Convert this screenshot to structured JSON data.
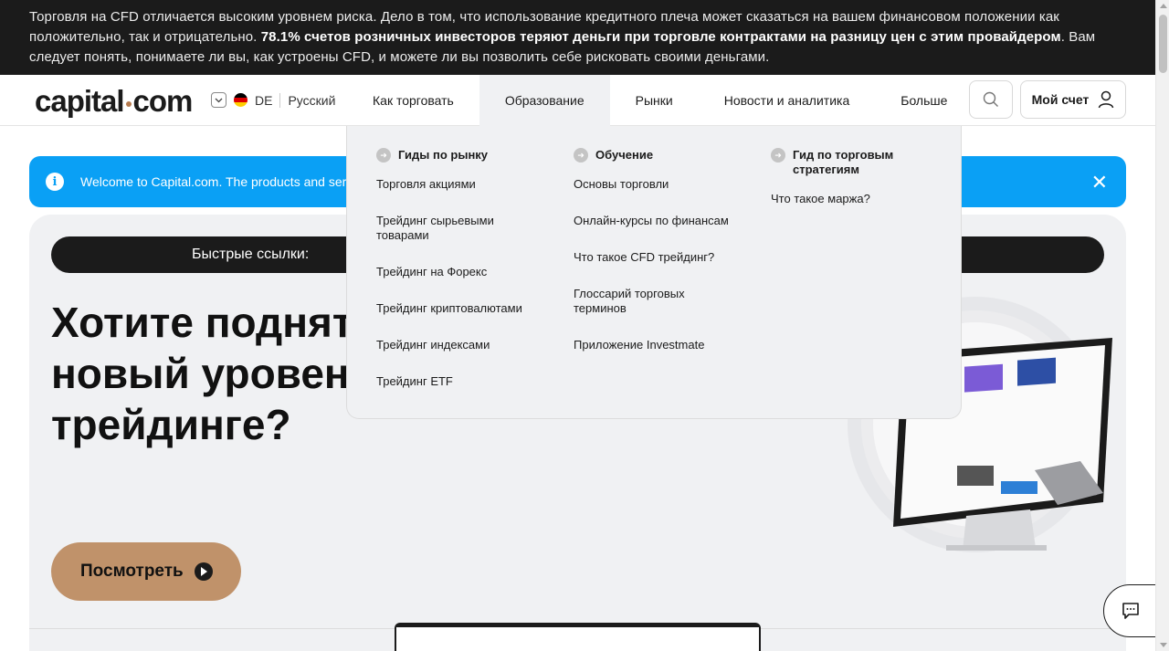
{
  "risk_banner": {
    "text_before": "Торговля на CFD отличается высоким уровнем риска. Дело в том, что использование кредитного плеча может сказаться на вашем финансовом положении как положительно, так и отрицательно. ",
    "text_bold": "78.1% счетов розничных инвесторов теряют деньги при торговле контрактами на разницу цен с этим провайдером",
    "text_after": ". Вам следует понять, понимаете ли вы, как устроены CFD, и можете ли вы позволить себе рисковать своими деньгами."
  },
  "header": {
    "logo_left": "capital",
    "logo_right": "com",
    "country_code": "DE",
    "language": "Русский",
    "nav": [
      {
        "label": "Как торговать"
      },
      {
        "label": "Образование"
      },
      {
        "label": "Рынки"
      },
      {
        "label": "Новости и аналитика"
      },
      {
        "label": "Больше"
      }
    ],
    "account_label": "Мой счет"
  },
  "notice": {
    "text": "Welcome to Capital.com. The products and servic"
  },
  "hero": {
    "quick_links_label": "Быстрые ссылки:",
    "title_line1": "Хотите поднят",
    "title_line2": "новый уровен",
    "title_line3": "трейдинге?",
    "cta_label": "Посмотреть"
  },
  "dropdown": {
    "columns": [
      {
        "heading": "Гиды по рынку",
        "links": [
          "Торговля акциями",
          "Трейдинг сырьевыми товарами",
          "Трейдинг на Форекс",
          "Трейдинг криптовалютами",
          "Трейдинг индексами",
          "Трейдинг ETF"
        ]
      },
      {
        "heading": "Обучение",
        "links": [
          "Основы торговли",
          "Онлайн-курсы по финансам",
          "Что такое CFD трейдинг?",
          "Глоссарий торговых терминов",
          "Приложение Investmate"
        ]
      },
      {
        "heading": "Гид по торговым стратегиям",
        "links": [
          "Что такое маржа?"
        ]
      }
    ]
  },
  "colors": {
    "dark": "#1b1b1b",
    "accent": "#c0926a",
    "notice_blue": "#0aa0f5",
    "panel": "#f0f1f3"
  },
  "icons": [
    "chevron-down-icon",
    "germany-flag-icon",
    "search-icon",
    "user-icon",
    "info-icon",
    "close-icon",
    "play-icon",
    "arrow-right-icon",
    "chat-icon"
  ]
}
